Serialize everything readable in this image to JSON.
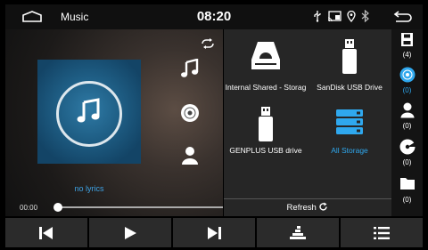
{
  "status_bar": {
    "app_title": "Music",
    "clock": "08:20",
    "icons": [
      "home-icon",
      "usb-icon",
      "screen-cast-icon",
      "location-icon",
      "bluetooth-icon",
      "back-icon"
    ]
  },
  "player": {
    "lyrics_text": "no lyrics",
    "elapsed_time": "00:00",
    "progress": 0,
    "side_icons": [
      "repeat-icon",
      "music-note-icon",
      "disc-icon",
      "person-icon"
    ]
  },
  "storage_panel": {
    "items": [
      {
        "label": "Internal Shared - Storag",
        "icon": "storage-box-icon",
        "selected": false
      },
      {
        "label": "SanDisk USB Drive",
        "icon": "usb-drive-icon",
        "selected": false
      },
      {
        "label": "GENPLUS USB drive",
        "icon": "usb-drive-icon",
        "selected": false
      },
      {
        "label": "All Storage",
        "icon": "all-storage-icon",
        "selected": true
      }
    ],
    "refresh_label": "Refresh"
  },
  "right_rail": {
    "items": [
      {
        "icon": "sd-card-icon",
        "count": "(4)",
        "active": false
      },
      {
        "icon": "music-disc-icon",
        "count": "(0)",
        "active": true
      },
      {
        "icon": "artist-icon",
        "count": "(0)",
        "active": false
      },
      {
        "icon": "album-icon",
        "count": "(0)",
        "active": false
      },
      {
        "icon": "folder-icon",
        "count": "(0)",
        "active": false
      }
    ]
  },
  "toolbar": {
    "buttons": [
      "previous-icon",
      "play-icon",
      "next-icon",
      "equalizer-icon",
      "playlist-icon"
    ]
  },
  "colors": {
    "accent": "#2fa8ee",
    "status_bar_bg": "#101010",
    "panel_bg": "#262626",
    "toolbar_btn_bg": "#2b2b2b"
  }
}
